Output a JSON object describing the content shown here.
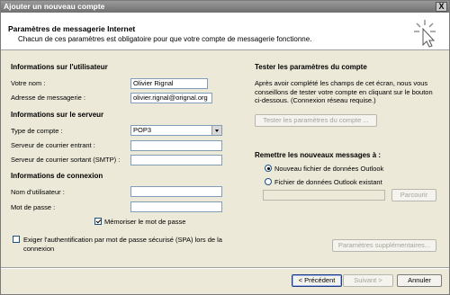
{
  "window": {
    "title": "Ajouter un nouveau compte",
    "close_label": "X"
  },
  "header": {
    "title": "Paramètres de messagerie Internet",
    "subtitle": "Chacun de ces paramètres est obligatoire pour que votre compte de messagerie fonctionne.",
    "icon": "cursor-click-icon"
  },
  "user_info": {
    "heading": "Informations sur l'utilisateur",
    "name_label": "Votre nom :",
    "name_value": "Olivier Rignal",
    "email_label": "Adresse de messagerie :",
    "email_value": "olivier.rignal@orignal.org"
  },
  "server_info": {
    "heading": "Informations sur le serveur",
    "account_type_label": "Type de compte :",
    "account_type_value": "POP3",
    "incoming_label": "Serveur de courrier entrant :",
    "incoming_value": "",
    "outgoing_label": "Serveur de courrier sortant (SMTP) :",
    "outgoing_value": ""
  },
  "login_info": {
    "heading": "Informations de connexion",
    "username_label": "Nom d'utilisateur :",
    "username_value": "",
    "password_label": "Mot de passe :",
    "password_value": "",
    "remember_label": "Mémoriser le mot de passe",
    "remember_checked": true,
    "spa_label": "Exiger l'authentification par mot de passe sécurisé (SPA) lors de la connexion",
    "spa_checked": false
  },
  "test": {
    "heading": "Tester les paramètres du compte",
    "description": "Après avoir complété les champs de cet écran, nous vous conseillons de tester votre compte en cliquant sur le bouton ci-dessous. (Connexion réseau requise.)",
    "button_label": "Tester les paramètres du compte ..."
  },
  "delivery": {
    "heading": "Remettre les nouveaux messages à :",
    "option_new": "Nouveau fichier de données Outlook",
    "option_existing": "Fichier de données Outlook existant",
    "existing_path": "",
    "browse_label": "Parcourir",
    "selected": "new"
  },
  "more_settings_label": "Paramètres supplémentaires...",
  "footer": {
    "back_label": "< Précédent",
    "next_label": "Suivant >",
    "cancel_label": "Annuler"
  },
  "colors": {
    "field_border": "#7f9db9",
    "dialog_bg": "#ece9d8",
    "disabled_text": "#a5a39a"
  }
}
